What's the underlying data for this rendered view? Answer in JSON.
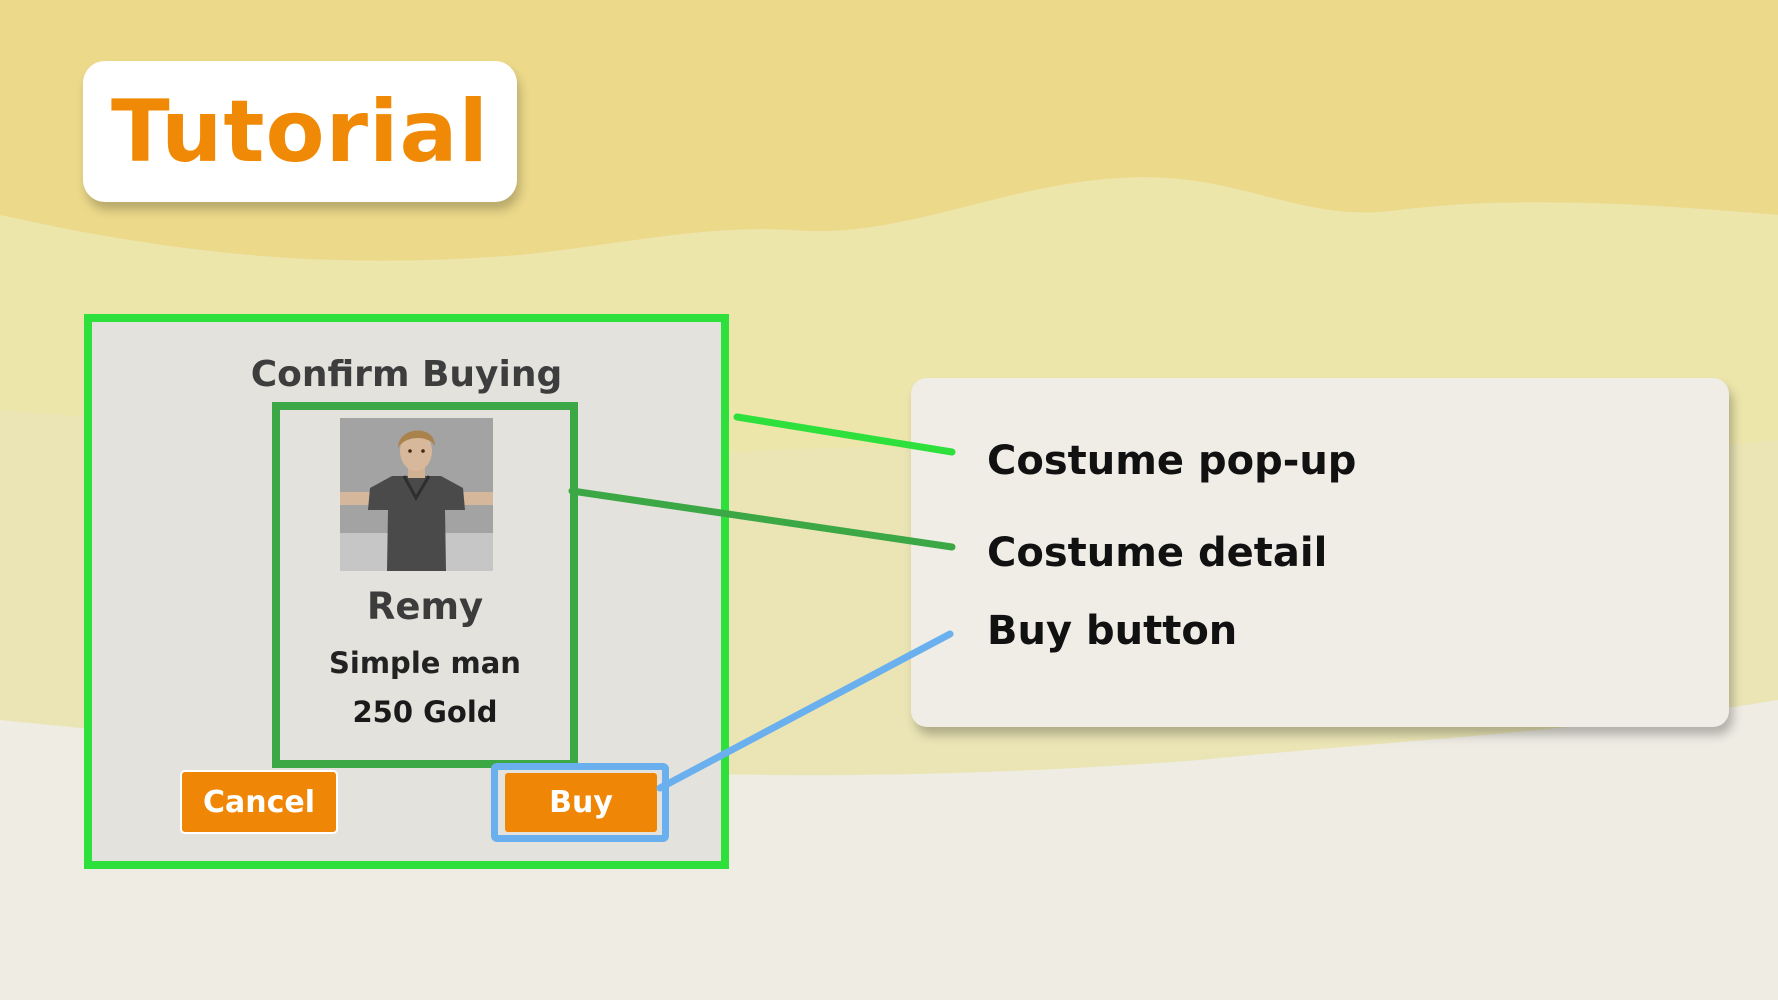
{
  "tutorial": {
    "title": "Tutorial"
  },
  "popup": {
    "title": "Confirm Buying",
    "item": {
      "name": "Remy",
      "description": "Simple man",
      "price": "250 Gold"
    },
    "cancel_label": "Cancel",
    "buy_label": "Buy"
  },
  "callouts": {
    "popup": "Costume pop-up",
    "detail": "Costume detail",
    "buy": "Buy button"
  },
  "colors": {
    "accent_orange": "#f08a06",
    "popup_outline": "#2ee03c",
    "detail_outline": "#3ba845",
    "buy_outline": "#6ab0ee"
  },
  "icons": {
    "character_preview": "character-thumbnail"
  }
}
